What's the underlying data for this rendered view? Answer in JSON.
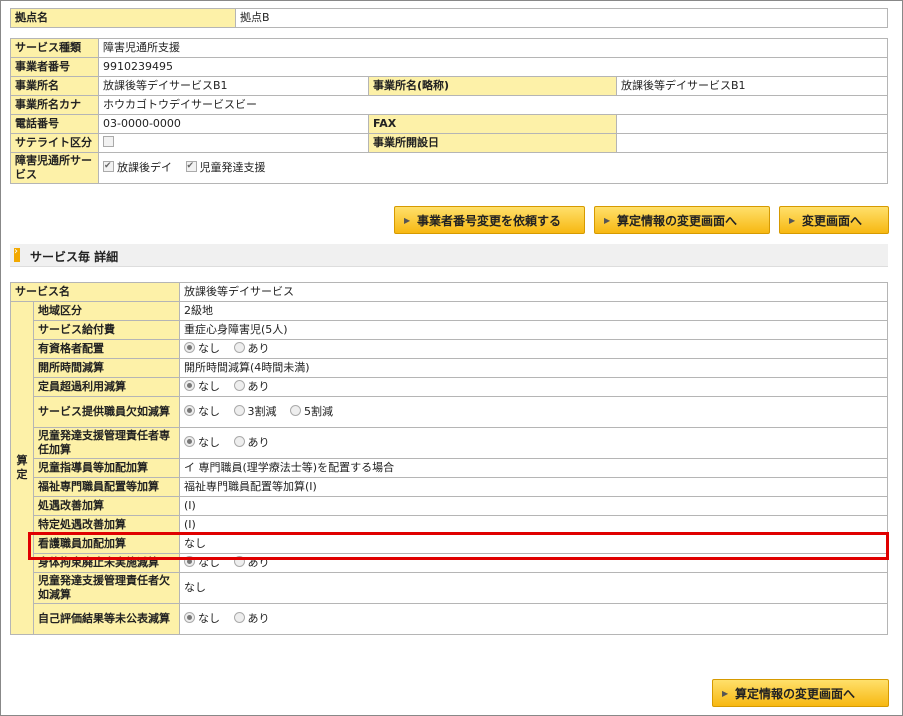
{
  "top": {
    "label": "拠点名",
    "value": "拠点B"
  },
  "info": {
    "service_type_label": "サービス種類",
    "service_type_value": "障害児通所支援",
    "biz_no_label": "事業者番号",
    "biz_no_value": "9910239495",
    "office_name_label": "事業所名",
    "office_name_value": "放課後等デイサービスB1",
    "office_short_label": "事業所名(略称)",
    "office_short_value": "放課後等デイサービスB1",
    "office_kana_label": "事業所名カナ",
    "office_kana_value": "ホウカゴトウデイサービスビー",
    "tel_label": "電話番号",
    "tel_value": "03-0000-0000",
    "fax_label": "FAX",
    "fax_value": "",
    "satellite_label": "サテライト区分",
    "open_date_label": "事業所開設日",
    "open_date_value": "",
    "svc_label": "障害児通所サービス",
    "svc_opt1": "放課後デイ",
    "svc_opt2": "児童発達支援"
  },
  "buttons": {
    "request_biz_no": "事業者番号変更を依頼する",
    "calc_change_1": "算定情報の変更画面へ",
    "change": "変更画面へ",
    "calc_change_2": "算定情報の変更画面へ"
  },
  "section": {
    "title": "サービス毎 詳細"
  },
  "detail": {
    "service_name_label": "サービス名",
    "service_name_value": "放課後等デイサービス",
    "santei_label": "算定",
    "rows": {
      "area_label": "地域区分",
      "area_value": "2級地",
      "fee_label": "サービス給付費",
      "fee_value": "重症心身障害児(5人)",
      "qualified_label": "有資格者配置",
      "hours_label": "開所時間減算",
      "hours_value": "開所時間減算(4時間未満)",
      "over_label": "定員超過利用減算",
      "lack_label": "サービス提供職員欠如減算",
      "manager_label": "児童発達支援管理責任者専任加算",
      "instructor_label": "児童指導員等加配加算",
      "instructor_value": "イ 専門職員(理学療法士等)を配置する場合",
      "welfare_label": "福祉専門職員配置等加算",
      "welfare_value": "福祉専門職員配置等加算(Ⅰ)",
      "treat_label": "処遇改善加算",
      "treat_value": "(Ⅰ)",
      "spec_treat_label": "特定処遇改善加算",
      "spec_treat_value": "(Ⅰ)",
      "nurse_label": "看護職員加配加算",
      "nurse_value": "なし",
      "restraint_label": "身体拘束廃止未実施減算",
      "mgr_lack_label": "児童発達支援管理責任者欠如減算",
      "mgr_lack_value": "なし",
      "self_eval_label": "自己評価結果等未公表減算"
    },
    "opts": {
      "none": "なし",
      "exist": "あり",
      "cut3": "3割減",
      "cut5": "5割減"
    }
  }
}
